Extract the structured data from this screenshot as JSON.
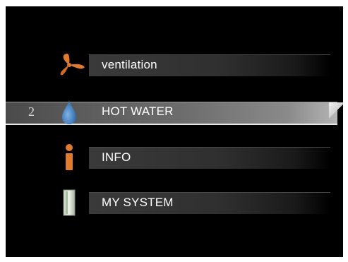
{
  "menu": {
    "items": [
      {
        "label": "ventilation",
        "icon": "fan-icon",
        "selected": false
      },
      {
        "label": "HOT WATER",
        "icon": "water-drop-icon",
        "selected": true,
        "number": "2"
      },
      {
        "label": "INFO",
        "icon": "info-icon",
        "selected": false
      },
      {
        "label": "MY SYSTEM",
        "icon": "system-panel-icon",
        "selected": false
      }
    ]
  },
  "colors": {
    "background": "#000000",
    "text": "#ffffff",
    "accent_orange": "#e07a2e",
    "accent_blue": "#3f7fc2"
  }
}
